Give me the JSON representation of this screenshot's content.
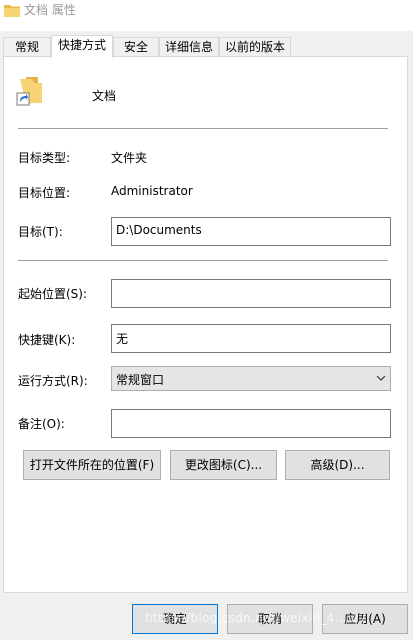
{
  "window": {
    "title": "文档 属性",
    "icon": "folder-icon"
  },
  "tabs": [
    {
      "label": "常规"
    },
    {
      "label": "快捷方式"
    },
    {
      "label": "安全"
    },
    {
      "label": "详细信息"
    },
    {
      "label": "以前的版本"
    }
  ],
  "active_tab": "快捷方式",
  "header": {
    "icon": "folder-shortcut-icon",
    "name": "文档"
  },
  "fields": {
    "target_type_label": "目标类型:",
    "target_type_value": "文件夹",
    "target_location_label": "目标位置:",
    "target_location_value": "Administrator",
    "target_label": "目标(T):",
    "target_value": "D:\\Documents",
    "start_in_label": "起始位置(S):",
    "start_in_value": "",
    "shortcut_key_label": "快捷键(K):",
    "shortcut_key_value": "无",
    "run_label": "运行方式(R):",
    "run_value": "常规窗口",
    "comment_label": "备注(O):",
    "comment_value": ""
  },
  "buttons": {
    "open_location": "打开文件所在的位置(F)",
    "change_icon": "更改图标(C)...",
    "advanced": "高级(D)...",
    "ok": "确定",
    "cancel": "取消",
    "apply": "应用(A)"
  },
  "watermark": "https://blog.csdn.net/weixin_4....27",
  "colors": {
    "ok_border": "#0078d7",
    "panel_bg": "#ffffff",
    "dialog_bg": "#f0f0f0"
  }
}
